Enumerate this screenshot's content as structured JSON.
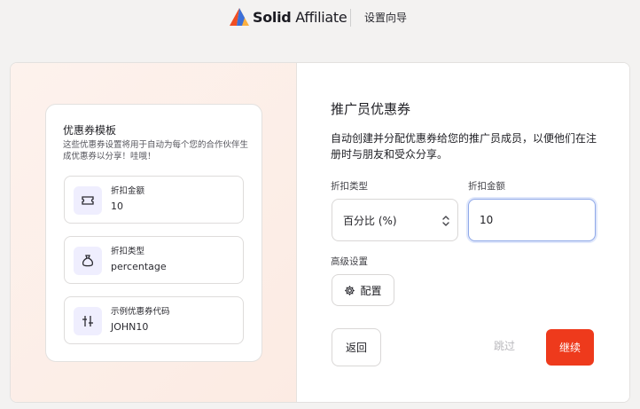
{
  "header": {
    "brand_bold": "Solid",
    "brand_regular": "Affiliate",
    "wizard_label": "设置向导",
    "logo_icon": "solid-affiliate-logo-icon"
  },
  "template_panel": {
    "title": "优惠券模板",
    "description": "这些优惠券设置将用于自动为每个您的合作伙伴生成优惠券以分享！哇哦！",
    "items": [
      {
        "label": "折扣金额",
        "value": "10",
        "icon": "ticket-icon"
      },
      {
        "label": "折扣类型",
        "value": "percentage",
        "icon": "money-bag-icon"
      },
      {
        "label": "示例优惠券代码",
        "value": "JOHN10",
        "icon": "code-sliders-icon"
      }
    ]
  },
  "form": {
    "title": "推广员优惠券",
    "description": "自动创建并分配优惠券给您的推广员成员，以便他们在注册时与朋友和受众分享。",
    "discount_type_label": "折扣类型",
    "discount_type_value": "百分比 (%)",
    "discount_amount_label": "折扣金额",
    "discount_amount_value": "10",
    "advanced_label": "高级设置",
    "config_button": "配置",
    "back_button": "返回",
    "skip_button": "跳过",
    "continue_button": "继续"
  },
  "colors": {
    "accent": "#ee3a1c",
    "focus_border": "#8fa8e8",
    "icon_bg": "#efeefe"
  }
}
